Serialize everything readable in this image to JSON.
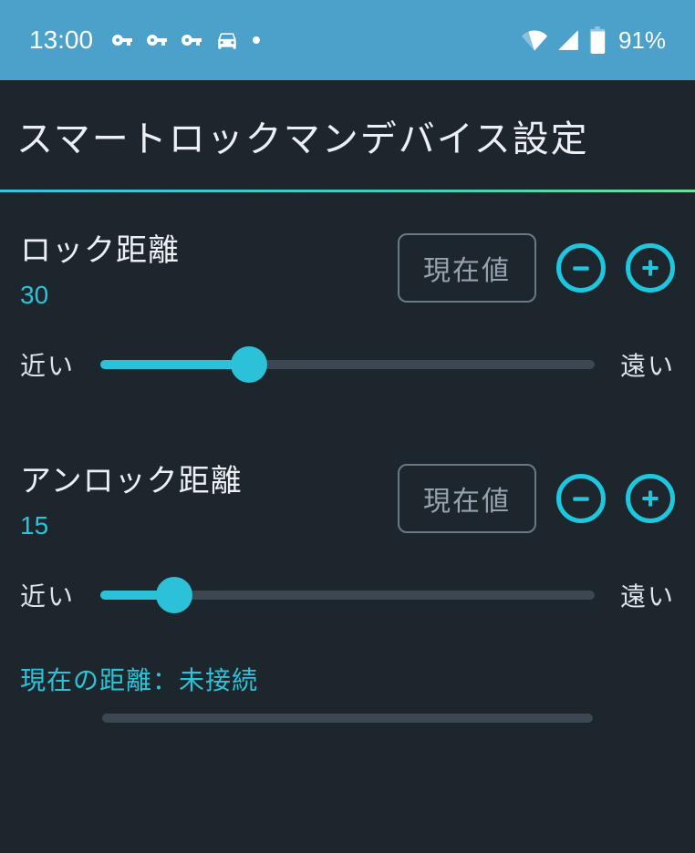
{
  "status": {
    "time": "13:00",
    "battery_pct": "91%"
  },
  "header": {
    "title": "スマートロックマンデバイス設定"
  },
  "sections": {
    "lock": {
      "label": "ロック距離",
      "value": "30",
      "current_btn": "現在値",
      "min_label": "近い",
      "max_label": "遠い",
      "slider_pct": 30
    },
    "unlock": {
      "label": "アンロック距離",
      "value": "15",
      "current_btn": "現在値",
      "min_label": "近い",
      "max_label": "遠い",
      "slider_pct": 15
    }
  },
  "current_distance": {
    "label": "現在の距離：未接続"
  }
}
